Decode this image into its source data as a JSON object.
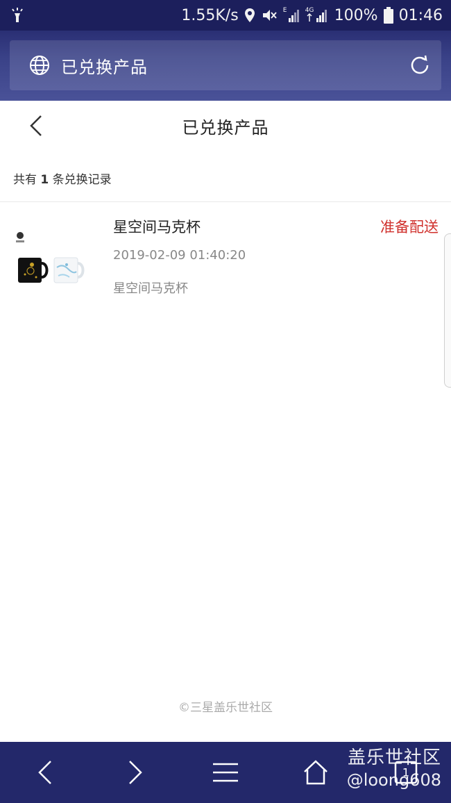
{
  "status_bar": {
    "speed": "1.55K/s",
    "network_e": "E",
    "network_4g": "4G",
    "battery": "100%",
    "time": "01:46"
  },
  "browser": {
    "title": "已兑换产品"
  },
  "header": {
    "title": "已兑换产品"
  },
  "summary": {
    "prefix": "共有",
    "count": "1",
    "suffix": "条兑换记录"
  },
  "orders": [
    {
      "name": "星空间马克杯",
      "status": "准备配送",
      "time": "2019-02-09 01:40:20",
      "description": "星空间马克杯"
    }
  ],
  "footer": {
    "copyright": "©三星盖乐世社区"
  },
  "bottom_nav": {
    "tab_count": "1"
  },
  "watermark": {
    "line1": "盖乐世社区",
    "line2": "@loong608"
  },
  "colors": {
    "status_bar": "#1c1f5c",
    "status_accent": "#d0312d",
    "bottom_nav": "#23286a"
  }
}
